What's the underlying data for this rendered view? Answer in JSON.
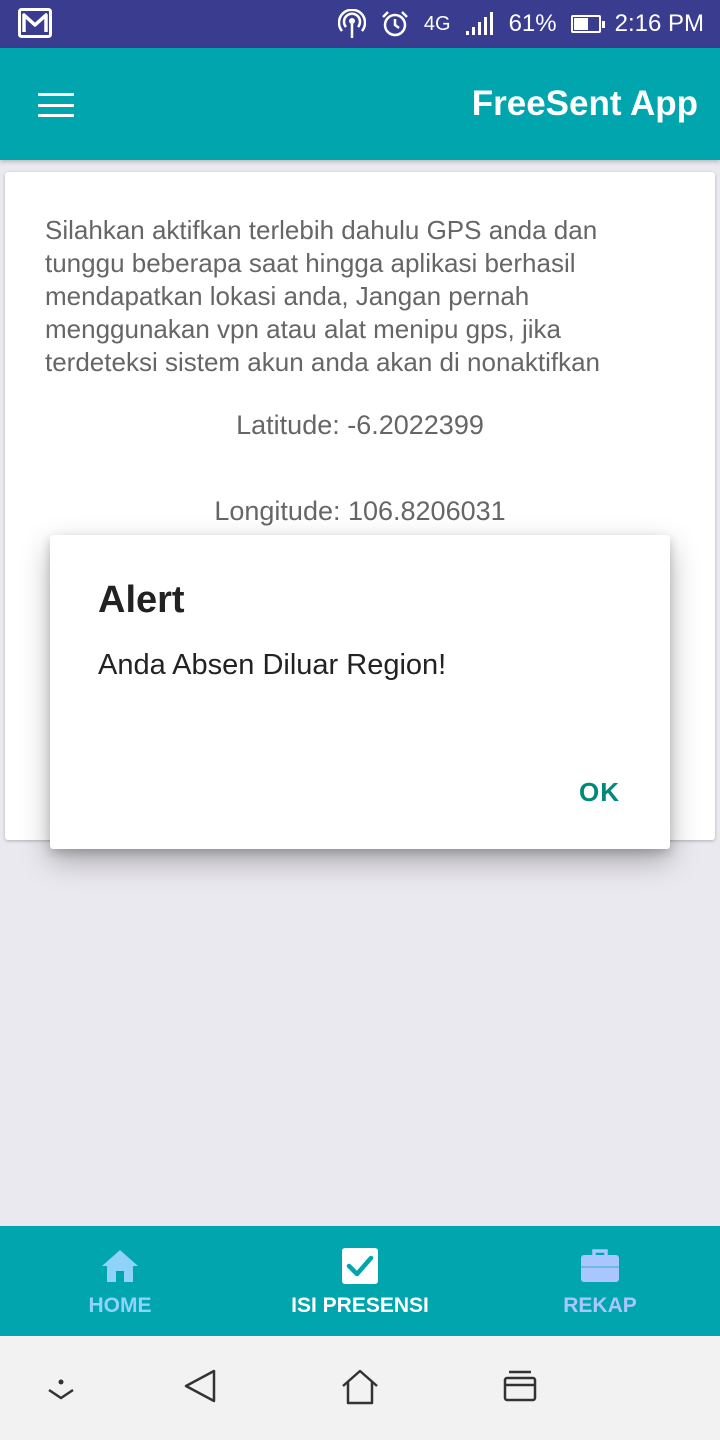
{
  "status_bar": {
    "network": "4G",
    "battery": "61%",
    "battery_level": 0.61,
    "time": "2:16 PM",
    "icons": [
      "gmail-icon",
      "hotspot-icon",
      "alarm-icon",
      "signal-icon",
      "battery-icon"
    ]
  },
  "app_bar": {
    "title": "FreeSent App",
    "menu_icon": "hamburger-menu-icon"
  },
  "card": {
    "instructions": "Silahkan aktifkan terlebih dahulu GPS anda dan tunggu beberapa saat hingga aplikasi berhasil mendapatkan lokasi anda, Jangan pernah menggunakan vpn atau alat menipu gps, jika terdeteksi sistem akun anda akan di nonaktifkan",
    "latitude": "Latitude: -6.2022399",
    "longitude": "Longitude: 106.8206031"
  },
  "dialog": {
    "title": "Alert",
    "message": "Anda Absen Diluar Region!",
    "ok_label": "OK"
  },
  "bottom_nav": {
    "items": [
      {
        "label": "HOME",
        "icon": "home-icon",
        "active": false
      },
      {
        "label": "ISI PRESENSI",
        "icon": "checkbox-icon",
        "active": true
      },
      {
        "label": "REKAP",
        "icon": "briefcase-icon",
        "active": false
      }
    ]
  },
  "system_nav": {
    "icons": [
      "collapse-icon",
      "back-icon",
      "home-nav-icon",
      "recents-icon"
    ]
  },
  "colors": {
    "status_bar": "#3a3d8f",
    "primary": "#00a5ad",
    "accent": "#00897b",
    "nav_inactive": "#8fd3f8"
  }
}
